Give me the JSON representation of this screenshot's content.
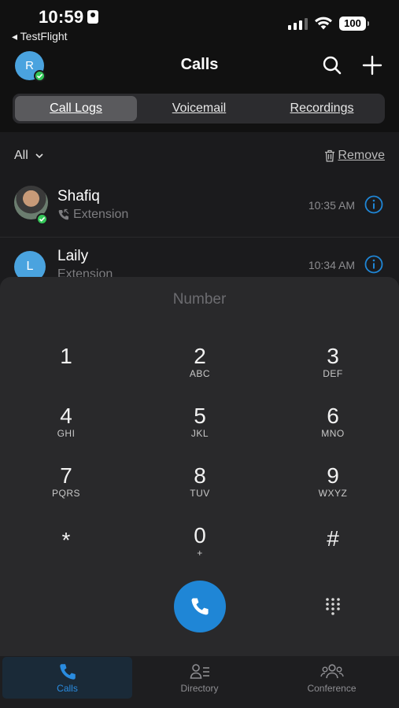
{
  "status_bar": {
    "time": "10:59",
    "back_app": "◂ TestFlight",
    "battery": "100"
  },
  "header": {
    "avatar_initial": "R",
    "title": "Calls"
  },
  "tabs": [
    {
      "label": "Call Logs",
      "active": true
    },
    {
      "label": "Voicemail",
      "active": false
    },
    {
      "label": "Recordings",
      "active": false
    }
  ],
  "filter": {
    "label": "All",
    "remove_label": "Remove"
  },
  "calls": [
    {
      "name": "Shafiq",
      "type": "Extension",
      "time": "10:35 AM",
      "status": "online"
    },
    {
      "name": "Laily",
      "initial": "L",
      "type": "Extension",
      "time": "10:34 AM",
      "status": "online"
    }
  ],
  "dialpad": {
    "placeholder": "Number",
    "keys": [
      {
        "digit": "1",
        "letters": ""
      },
      {
        "digit": "2",
        "letters": "ABC"
      },
      {
        "digit": "3",
        "letters": "DEF"
      },
      {
        "digit": "4",
        "letters": "GHI"
      },
      {
        "digit": "5",
        "letters": "JKL"
      },
      {
        "digit": "6",
        "letters": "MNO"
      },
      {
        "digit": "7",
        "letters": "PQRS"
      },
      {
        "digit": "8",
        "letters": "TUV"
      },
      {
        "digit": "9",
        "letters": "WXYZ"
      },
      {
        "digit": "*",
        "letters": ""
      },
      {
        "digit": "0",
        "letters": "+"
      },
      {
        "digit": "#",
        "letters": ""
      }
    ]
  },
  "bottom_nav": [
    {
      "label": "Calls",
      "active": true
    },
    {
      "label": "Directory",
      "active": false
    },
    {
      "label": "Conference",
      "active": false
    }
  ],
  "colors": {
    "accent": "#1f86d6",
    "online": "#34c759",
    "background": "#1b1b1d",
    "sheet": "#29292b"
  }
}
